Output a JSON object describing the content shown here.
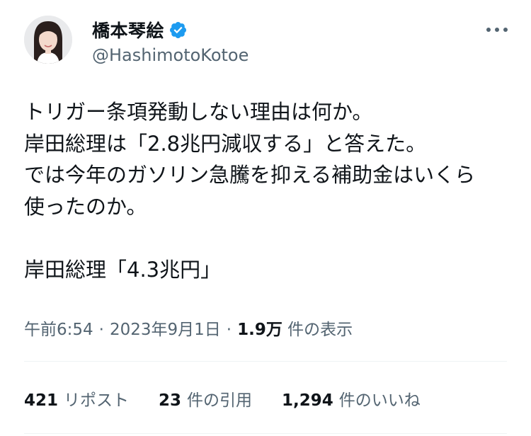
{
  "author": {
    "display_name": "橋本琴絵",
    "handle": "@HashimotoKotoe",
    "verified": true
  },
  "tweet": {
    "lines": [
      "トリガー条項発動しない理由は何か。",
      "岸田総理は「2.8兆円減収する」と答えた。",
      "では今年のガソリン急騰を抑える補助金はいくら",
      "使ったのか。",
      "岸田総理「4.3兆円」"
    ]
  },
  "meta": {
    "time": "午前6:54",
    "date": "2023年9月1日",
    "views_count": "1.9万",
    "views_label": "件の表示",
    "separator": "·"
  },
  "stats": {
    "reposts_count": "421",
    "reposts_label": "リポスト",
    "quotes_count": "23",
    "quotes_label": "件の引用",
    "likes_count": "1,294",
    "likes_label": "件のいいね"
  },
  "colors": {
    "text": "#0f1419",
    "secondary": "#536471",
    "verified_badge": "#1d9bf0",
    "divider": "#eff3f4"
  },
  "icons": {
    "verified": "verified-badge-icon",
    "more": "more-options-icon"
  }
}
